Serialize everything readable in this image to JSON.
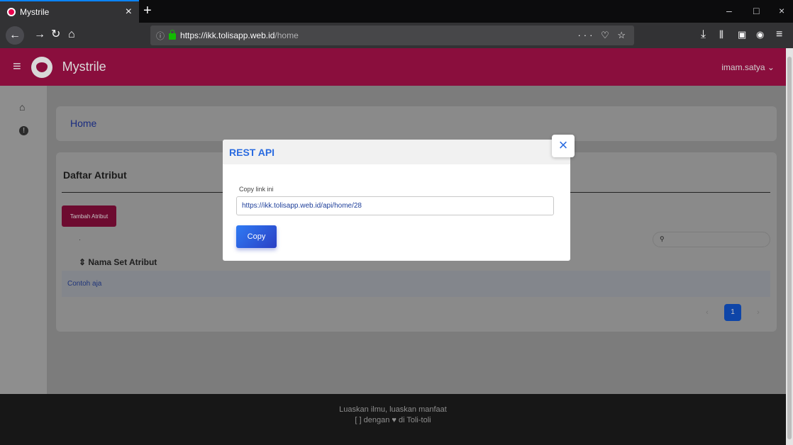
{
  "browser": {
    "tab_title": "Mystrile",
    "tab_close": "×",
    "new_tab": "+",
    "url_host": "https://ikk.tolisapp.web.id",
    "url_path": "/home",
    "url_actions": "··· ♡ ☆",
    "window_controls": [
      "–",
      "□",
      "×"
    ],
    "icons": [
      "back-icon",
      "forward-icon",
      "reload-icon",
      "home-icon",
      "info-icon",
      "lock-icon",
      "download-icon",
      "library-icon",
      "sidebar-icon",
      "account-icon",
      "menu-icon"
    ]
  },
  "app": {
    "brand": "Mystrile",
    "user_menu": "imam.satya ⌄",
    "theme_color": "#8a0e3d"
  },
  "sidebar": {
    "items": [
      {
        "icon": "home-icon"
      },
      {
        "icon": "alert-icon",
        "glyph": "!"
      }
    ]
  },
  "breadcrumb": {
    "label": "Home"
  },
  "section": {
    "title": "Daftar Atribut",
    "add_button": "Tambah Atribut",
    "dot_label": "·",
    "search_icon": "search-icon"
  },
  "table": {
    "columns": [
      "⇕ Nama Set Atribut"
    ],
    "rows": [
      [
        "Contoh aja"
      ]
    ]
  },
  "pagination": {
    "prev": "‹",
    "current": "1",
    "next": "›"
  },
  "footer": {
    "line1": "Luaskan ilmu, luaskan manfaat",
    "line2": "[ ] dengan ♥ di Toli-toli"
  },
  "modal": {
    "title": "REST API",
    "close": "×",
    "field_label": "Copy link ini",
    "link_value": "https://ikk.tolisapp.web.id/api/home/28",
    "copy_button": "Copy",
    "accent_color": "#2a6be0"
  }
}
